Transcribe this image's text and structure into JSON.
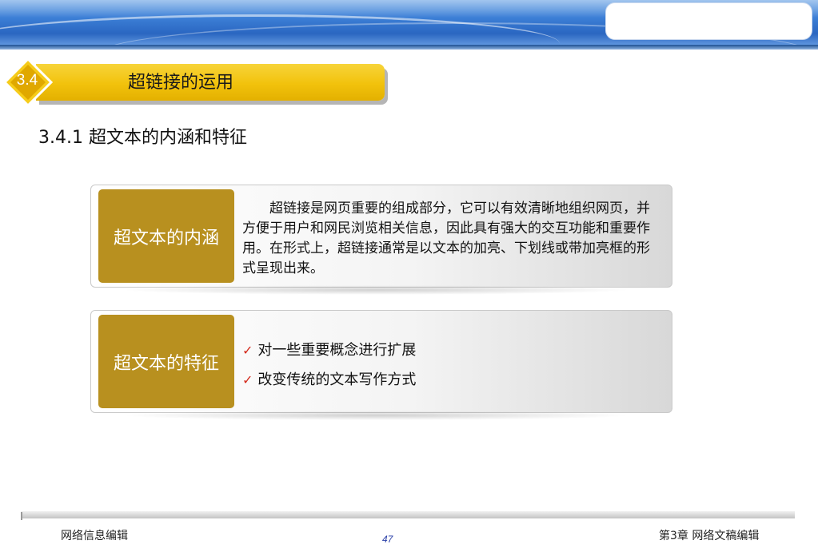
{
  "slide": {
    "section_number": "3.4",
    "section_title": "超链接的运用",
    "subheading": "3.4.1  超文本的内涵和特征"
  },
  "cards": [
    {
      "label": "超文本的内涵",
      "text": "超链接是网页重要的组成部分，它可以有效清晰地组织网页，并方便于用户和网民浏览相关信息，因此具有强大的交互功能和重要作用。在形式上，超链接通常是以文本的加亮、下划线或带加亮框的形式呈现出来。"
    },
    {
      "label": "超文本的特征",
      "bullets": [
        "对一些重要概念进行扩展",
        "改变传统的文本写作方式"
      ]
    }
  ],
  "footer": {
    "left": "网络信息编辑",
    "page": "47",
    "right": "第3章 网络文稿编辑"
  },
  "colors": {
    "section_bar": "#f2c20c",
    "card_label": "#b8901f",
    "check": "#d42a1c"
  },
  "icons": {
    "bullet": "check-mark-icon"
  }
}
